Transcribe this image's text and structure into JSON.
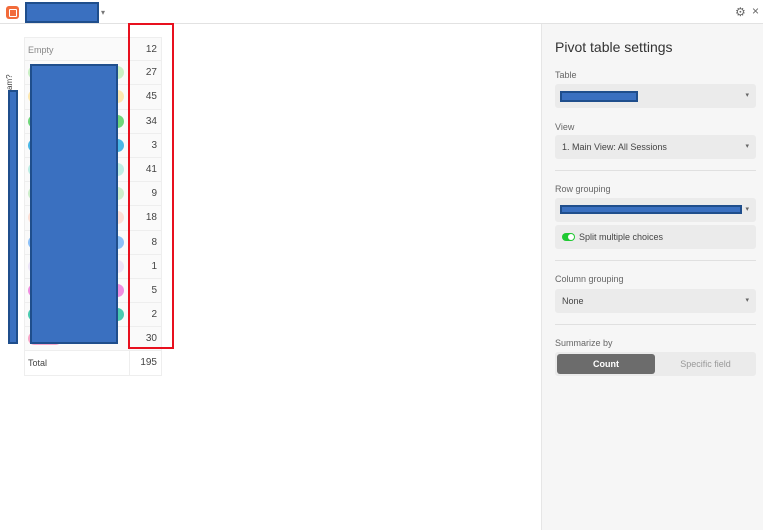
{
  "header": {
    "logo": "app-logo",
    "gear_icon": "⚙",
    "close_icon": "×",
    "caret": "▾"
  },
  "axis_label": "am?",
  "table": {
    "rows": [
      {
        "label": "Empty",
        "value": "12",
        "color": ""
      },
      {
        "label": "",
        "value": "27",
        "color": "#c9f0c4"
      },
      {
        "label": "",
        "value": "45",
        "color": "#fde8b0"
      },
      {
        "label": "",
        "value": "34",
        "color": "#6fd67a"
      },
      {
        "label": "",
        "value": "3",
        "color": "#4bb7e6"
      },
      {
        "label": "",
        "value": "41",
        "color": "#bdeee5"
      },
      {
        "label": "",
        "value": "9",
        "color": "#cdeecb"
      },
      {
        "label": "",
        "value": "18",
        "color": "#fde0d6"
      },
      {
        "label": "",
        "value": "8",
        "color": "#8cc0f7"
      },
      {
        "label": "",
        "value": "1",
        "color": "#ece4f9"
      },
      {
        "label": "",
        "value": "5",
        "color": "#ef8ee0"
      },
      {
        "label": "",
        "value": "2",
        "color": "#4bcbb0"
      },
      {
        "label": "",
        "value": "30",
        "color": "#f7a6c8"
      }
    ],
    "total_label": "Total",
    "total_value": "195"
  },
  "panel": {
    "title": "Pivot table settings",
    "table_label": "Table",
    "view_label": "View",
    "view_value": "1. Main View: All Sessions",
    "row_grouping_label": "Row grouping",
    "split_label": "Split multiple choices",
    "split_on": true,
    "column_grouping_label": "Column grouping",
    "column_grouping_value": "None",
    "summarize_label": "Summarize by",
    "count_label": "Count",
    "specific_label": "Specific field"
  }
}
